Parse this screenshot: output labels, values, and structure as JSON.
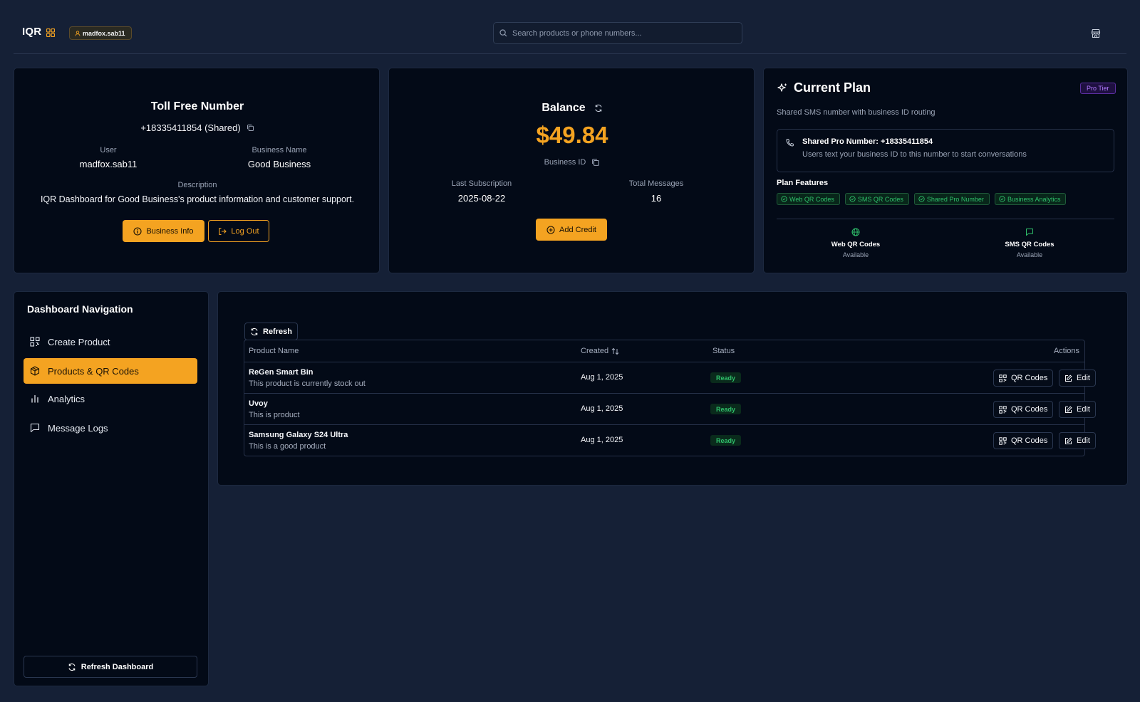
{
  "header": {
    "logo": "IQR",
    "username": "madfox.sab11",
    "search_placeholder": "Search products or phone numbers..."
  },
  "toll_free": {
    "title": "Toll Free Number",
    "number": "+18335411854 (Shared)",
    "user_label": "User",
    "user_value": "madfox.sab11",
    "business_name_label": "Business Name",
    "business_name_value": "Good Business",
    "description_label": "Description",
    "description_value": "IQR Dashboard for Good Business's product information and customer support.",
    "business_info_button": "Business Info",
    "logout_button": "Log Out"
  },
  "balance": {
    "title": "Balance",
    "amount": "$49.84",
    "business_id_label": "Business ID",
    "last_subscription_label": "Last Subscription",
    "last_subscription_value": "2025-08-22",
    "total_messages_label": "Total Messages",
    "total_messages_value": "16",
    "add_credit_button": "Add Credit"
  },
  "plan": {
    "title": "Current Plan",
    "tier_badge": "Pro Tier",
    "subtitle": "Shared SMS number with business ID routing",
    "shared_number_title": "Shared Pro Number: +18335411854",
    "shared_number_desc": "Users text your business ID to this number to start conversations",
    "features_label": "Plan Features",
    "features": [
      "Web QR Codes",
      "SMS QR Codes",
      "Shared Pro Number",
      "Business Analytics"
    ],
    "web_qr_label": "Web QR Codes",
    "web_qr_status": "Available",
    "sms_qr_label": "SMS QR Codes",
    "sms_qr_status": "Available"
  },
  "nav": {
    "title": "Dashboard Navigation",
    "items": [
      {
        "label": "Create Product",
        "icon": "qr-icon"
      },
      {
        "label": "Products & QR Codes",
        "icon": "box-icon"
      },
      {
        "label": "Analytics",
        "icon": "bar-chart-icon"
      },
      {
        "label": "Message Logs",
        "icon": "message-icon"
      }
    ],
    "refresh_button": "Refresh Dashboard"
  },
  "products": {
    "refresh_button": "Refresh",
    "columns": {
      "name": "Product Name",
      "created": "Created",
      "status": "Status",
      "actions": "Actions"
    },
    "qr_button": "QR Codes",
    "edit_button": "Edit",
    "rows": [
      {
        "name": "ReGen Smart Bin",
        "desc": "This product is currently stock out",
        "created": "Aug 1, 2025",
        "status": "Ready"
      },
      {
        "name": "Uvoy",
        "desc": "This is product",
        "created": "Aug 1, 2025",
        "status": "Ready"
      },
      {
        "name": "Samsung Galaxy S24 Ultra",
        "desc": "This is a good product",
        "created": "Aug 1, 2025",
        "status": "Ready"
      }
    ]
  },
  "colors": {
    "background": "#152036",
    "card": "#030a17",
    "accent": "#f4a321",
    "success": "#2fc06b",
    "pro_badge": "#a66bff"
  }
}
